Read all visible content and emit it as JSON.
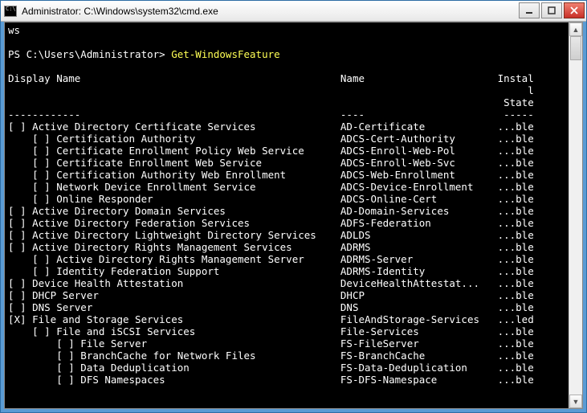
{
  "window": {
    "title": "Administrator: C:\\Windows\\system32\\cmd.exe"
  },
  "prompt_remnant": "ws",
  "prompt": "PS C:\\Users\\Administrator>",
  "command": "Get-WindowsFeature",
  "headers": {
    "display": "Display Name",
    "name": "Name",
    "install": "Instal",
    "install2": "l",
    "state": "State"
  },
  "separator": {
    "display": "------------",
    "name": "----",
    "state": "-----"
  },
  "rows": [
    {
      "indent": 0,
      "mark": "[ ]",
      "display": "Active Directory Certificate Services",
      "name": "AD-Certificate",
      "state": "...ble"
    },
    {
      "indent": 1,
      "mark": "[ ]",
      "display": "Certification Authority",
      "name": "ADCS-Cert-Authority",
      "state": "...ble"
    },
    {
      "indent": 1,
      "mark": "[ ]",
      "display": "Certificate Enrollment Policy Web Service",
      "name": "ADCS-Enroll-Web-Pol",
      "state": "...ble"
    },
    {
      "indent": 1,
      "mark": "[ ]",
      "display": "Certificate Enrollment Web Service",
      "name": "ADCS-Enroll-Web-Svc",
      "state": "...ble"
    },
    {
      "indent": 1,
      "mark": "[ ]",
      "display": "Certification Authority Web Enrollment",
      "name": "ADCS-Web-Enrollment",
      "state": "...ble"
    },
    {
      "indent": 1,
      "mark": "[ ]",
      "display": "Network Device Enrollment Service",
      "name": "ADCS-Device-Enrollment",
      "state": "...ble"
    },
    {
      "indent": 1,
      "mark": "[ ]",
      "display": "Online Responder",
      "name": "ADCS-Online-Cert",
      "state": "...ble"
    },
    {
      "indent": 0,
      "mark": "[ ]",
      "display": "Active Directory Domain Services",
      "name": "AD-Domain-Services",
      "state": "...ble"
    },
    {
      "indent": 0,
      "mark": "[ ]",
      "display": "Active Directory Federation Services",
      "name": "ADFS-Federation",
      "state": "...ble"
    },
    {
      "indent": 0,
      "mark": "[ ]",
      "display": "Active Directory Lightweight Directory Services",
      "name": "ADLDS",
      "state": "...ble"
    },
    {
      "indent": 0,
      "mark": "[ ]",
      "display": "Active Directory Rights Management Services",
      "name": "ADRMS",
      "state": "...ble"
    },
    {
      "indent": 1,
      "mark": "[ ]",
      "display": "Active Directory Rights Management Server",
      "name": "ADRMS-Server",
      "state": "...ble"
    },
    {
      "indent": 1,
      "mark": "[ ]",
      "display": "Identity Federation Support",
      "name": "ADRMS-Identity",
      "state": "...ble"
    },
    {
      "indent": 0,
      "mark": "[ ]",
      "display": "Device Health Attestation",
      "name": "DeviceHealthAttestat...",
      "state": "...ble"
    },
    {
      "indent": 0,
      "mark": "[ ]",
      "display": "DHCP Server",
      "name": "DHCP",
      "state": "...ble"
    },
    {
      "indent": 0,
      "mark": "[ ]",
      "display": "DNS Server",
      "name": "DNS",
      "state": "...ble"
    },
    {
      "indent": 0,
      "mark": "[X]",
      "display": "File and Storage Services",
      "name": "FileAndStorage-Services",
      "state": "...led"
    },
    {
      "indent": 1,
      "mark": "[ ]",
      "display": "File and iSCSI Services",
      "name": "File-Services",
      "state": "...ble"
    },
    {
      "indent": 2,
      "mark": "[ ]",
      "display": "File Server",
      "name": "FS-FileServer",
      "state": "...ble"
    },
    {
      "indent": 2,
      "mark": "[ ]",
      "display": "BranchCache for Network Files",
      "name": "FS-BranchCache",
      "state": "...ble"
    },
    {
      "indent": 2,
      "mark": "[ ]",
      "display": "Data Deduplication",
      "name": "FS-Data-Deduplication",
      "state": "...ble"
    },
    {
      "indent": 2,
      "mark": "[ ]",
      "display": "DFS Namespaces",
      "name": "FS-DFS-Namespace",
      "state": "...ble"
    }
  ]
}
